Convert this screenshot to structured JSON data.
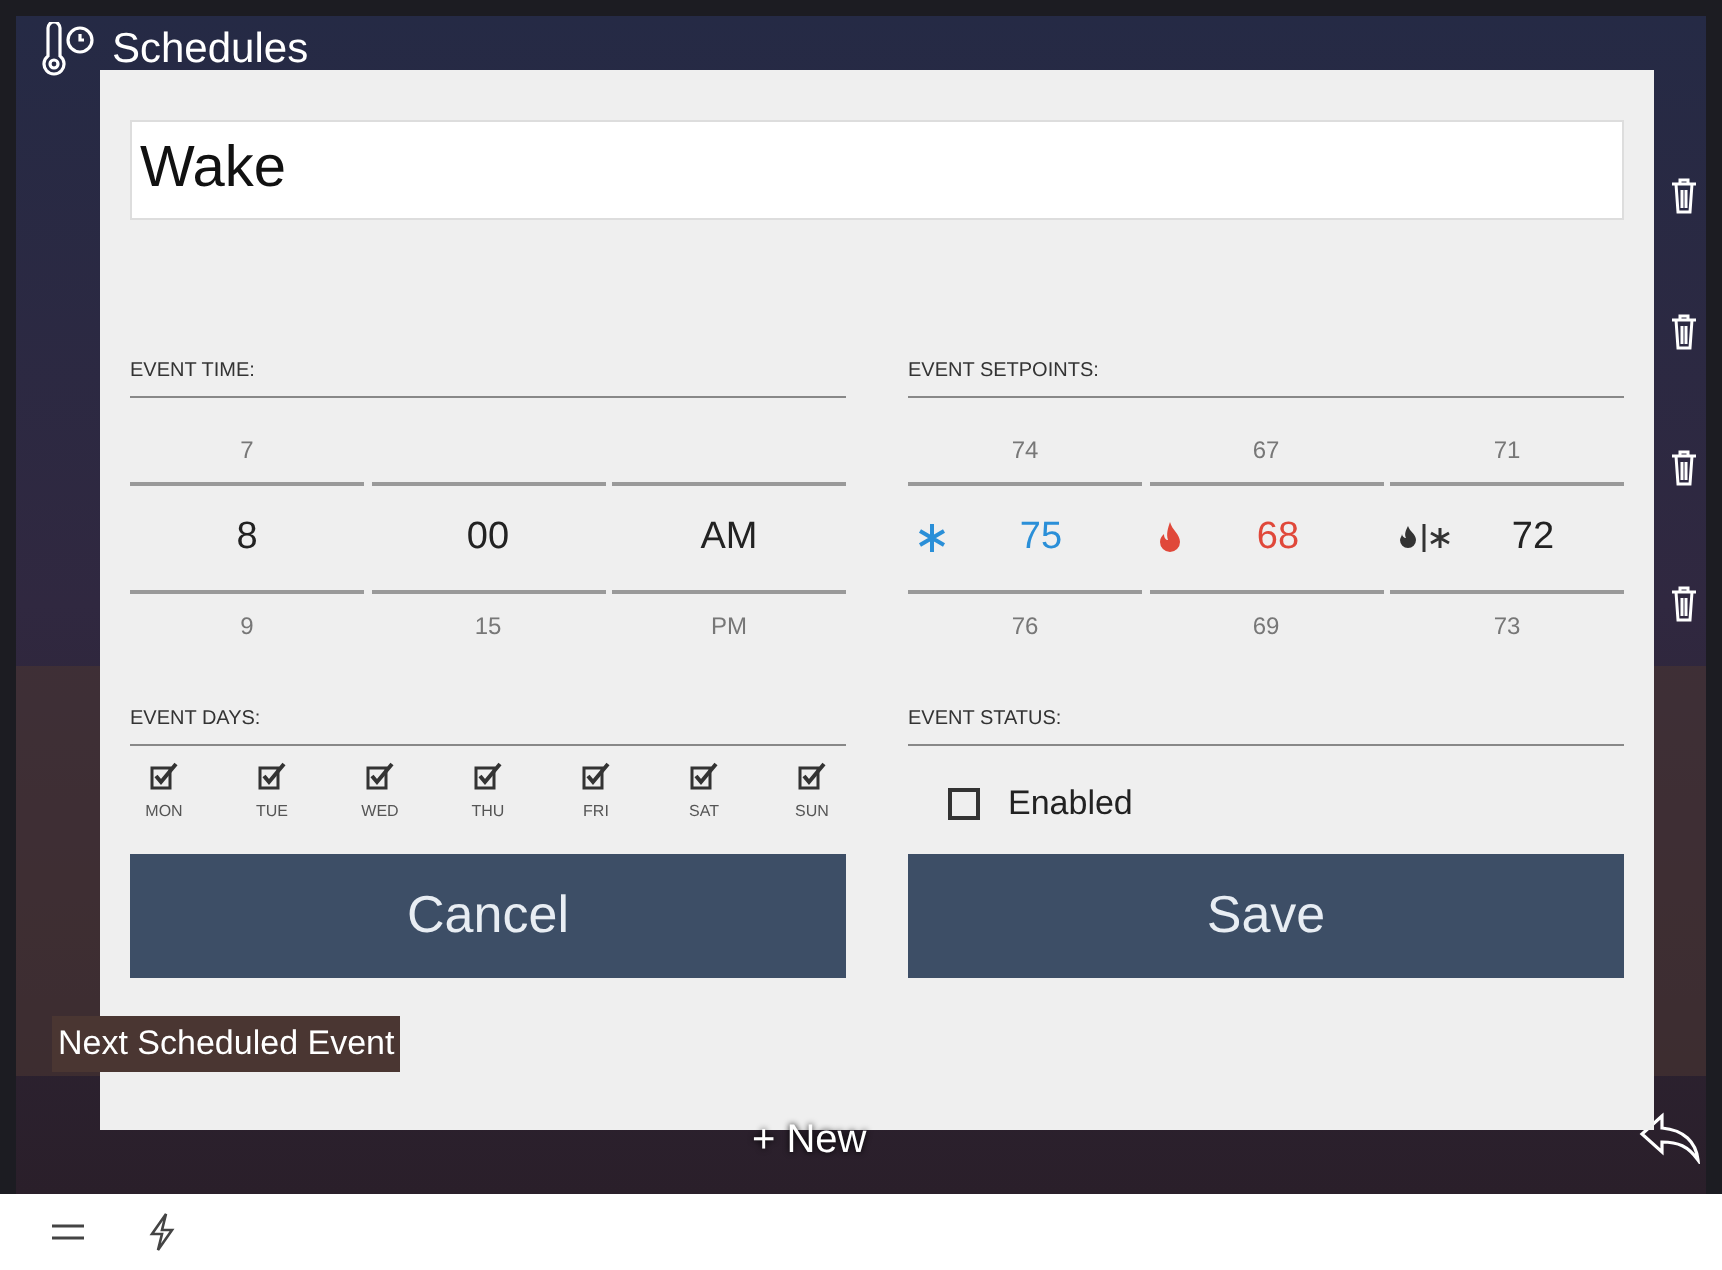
{
  "app": {
    "title": "Schedules",
    "next_event_label": "Next Scheduled Event",
    "new_button": "+ New"
  },
  "dialog": {
    "name": "Wake",
    "time": {
      "label": "EVENT TIME:",
      "columns": [
        {
          "above": "7",
          "value": "8",
          "below": "9"
        },
        {
          "value": "00",
          "below": "15"
        },
        {
          "value": "AM",
          "below": "PM"
        }
      ]
    },
    "setpoints": {
      "label": "EVENT SETPOINTS:",
      "columns": [
        {
          "kind": "cool",
          "above": "74",
          "value": "75",
          "below": "76"
        },
        {
          "kind": "heat",
          "above": "67",
          "value": "68",
          "below": "69"
        },
        {
          "kind": "auto",
          "above": "71",
          "value": "72",
          "below": "73"
        }
      ]
    },
    "days": {
      "label": "EVENT DAYS:",
      "items": [
        {
          "label": "MON",
          "checked": true
        },
        {
          "label": "TUE",
          "checked": true
        },
        {
          "label": "WED",
          "checked": true
        },
        {
          "label": "THU",
          "checked": true
        },
        {
          "label": "FRI",
          "checked": true
        },
        {
          "label": "SAT",
          "checked": true
        },
        {
          "label": "SUN",
          "checked": true
        }
      ]
    },
    "status": {
      "label": "EVENT STATUS:",
      "option": {
        "label": "Enabled",
        "checked": false
      }
    },
    "buttons": [
      {
        "label": "Cancel"
      },
      {
        "label": "Save"
      }
    ]
  }
}
